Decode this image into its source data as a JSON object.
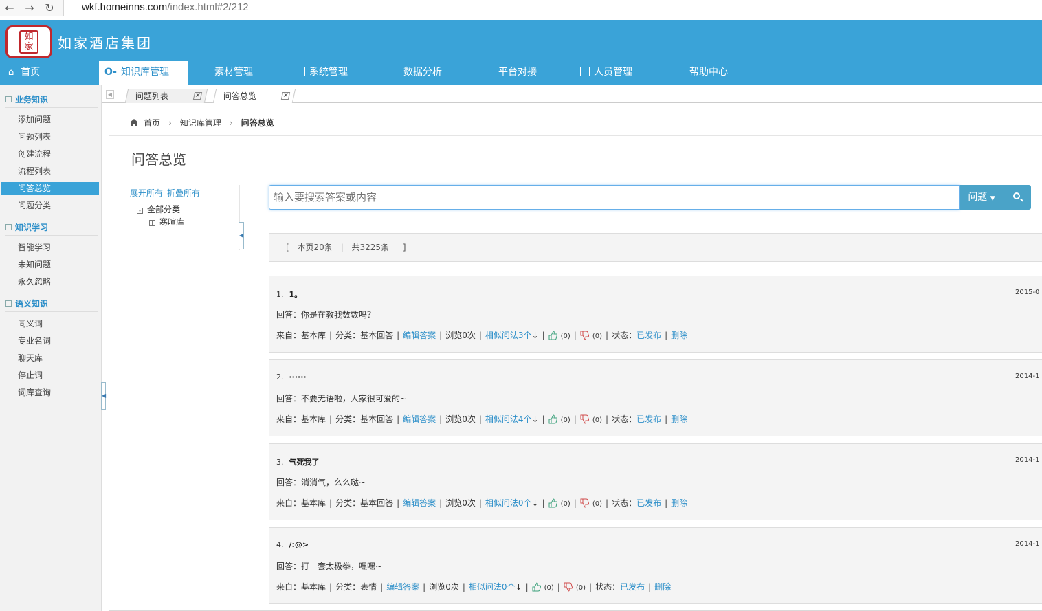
{
  "browser": {
    "url_host": "wkf.homeinns.com",
    "url_path": "/index.html#2/212"
  },
  "brand": {
    "logo_text": "如家",
    "name": "如家酒店集团"
  },
  "topnav": [
    {
      "label": "首页",
      "icon": "home-icon"
    },
    {
      "label": "知识库管理",
      "icon": "key-icon",
      "active": true
    },
    {
      "label": "素材管理",
      "icon": "bar-chart-icon"
    },
    {
      "label": "系统管理",
      "icon": "monitor-icon"
    },
    {
      "label": "数据分析",
      "icon": "grid-chart-icon"
    },
    {
      "label": "平台对接",
      "icon": "image-icon"
    },
    {
      "label": "人员管理",
      "icon": "user-icon"
    },
    {
      "label": "帮助中心",
      "icon": "windows-icon"
    }
  ],
  "sidebar": {
    "sections": [
      {
        "title": "业务知识",
        "items": [
          "添加问题",
          "问题列表",
          "创建流程",
          "流程列表",
          "问答总览",
          "问题分类"
        ]
      },
      {
        "title": "知识学习",
        "items": [
          "智能学习",
          "未知问题",
          "永久忽略"
        ]
      },
      {
        "title": "语义知识",
        "items": [
          "同义词",
          "专业名词",
          "聊天库",
          "停止词",
          "词库查询"
        ]
      }
    ],
    "active_item": "问答总览"
  },
  "tabs": [
    {
      "label": "问题列表"
    },
    {
      "label": "问答总览",
      "active": true
    }
  ],
  "breadcrumb": {
    "home": "首页",
    "parent": "知识库管理",
    "current": "问答总览"
  },
  "page_title": "问答总览",
  "tree": {
    "expand_all": "展开所有",
    "collapse_all": "折叠所有",
    "root": "全部分类",
    "child": "寒暄库"
  },
  "search": {
    "placeholder": "输入要搜索答案或内容",
    "type_label": "问题"
  },
  "pager": {
    "open": "[",
    "page_count": "本页20条",
    "sep": "|",
    "total": "共3225条",
    "close": "]"
  },
  "cards": [
    {
      "num": "1.",
      "question": "1。",
      "date": "2015-0",
      "answer": "回答：你是在教我数数吗？",
      "source": "来自：基本库",
      "category": "分类：基本回答",
      "edit": "编辑答案",
      "views": "浏览0次",
      "similar": "相似问法3个",
      "up": "(0)",
      "down": "(0)",
      "status_label": "状态：",
      "status": "已发布",
      "delete": "删除"
    },
    {
      "num": "2.",
      "question": "······",
      "date": "2014-1",
      "answer": "回答：不要无语啦，人家很可爱的~",
      "source": "来自：基本库",
      "category": "分类：基本回答",
      "edit": "编辑答案",
      "views": "浏览0次",
      "similar": "相似问法4个",
      "up": "(0)",
      "down": "(0)",
      "status_label": "状态：",
      "status": "已发布",
      "delete": "删除"
    },
    {
      "num": "3.",
      "question": "气死我了",
      "date": "2014-1",
      "answer": "回答：消消气，么么哒~",
      "source": "来自：基本库",
      "category": "分类：基本回答",
      "edit": "编辑答案",
      "views": "浏览0次",
      "similar": "相似问法0个",
      "up": "(0)",
      "down": "(0)",
      "status_label": "状态：",
      "status": "已发布",
      "delete": "删除"
    },
    {
      "num": "4.",
      "question": "/:@>",
      "date": "2014-1",
      "answer": "回答：打一套太极拳，嘿嘿~",
      "source": "来自：基本库",
      "category": "分类：表情",
      "edit": "编辑答案",
      "views": "浏览0次",
      "similar": "相似问法0个",
      "up": "(0)",
      "down": "(0)",
      "status_label": "状态：",
      "status": "已发布",
      "delete": "删除"
    }
  ],
  "colors": {
    "header_blue": "#3aa3d8",
    "link_blue": "#2d8fc9",
    "logo_red": "#c0282d",
    "thumb_up": "#3aa07a",
    "thumb_down": "#d04a4a"
  }
}
